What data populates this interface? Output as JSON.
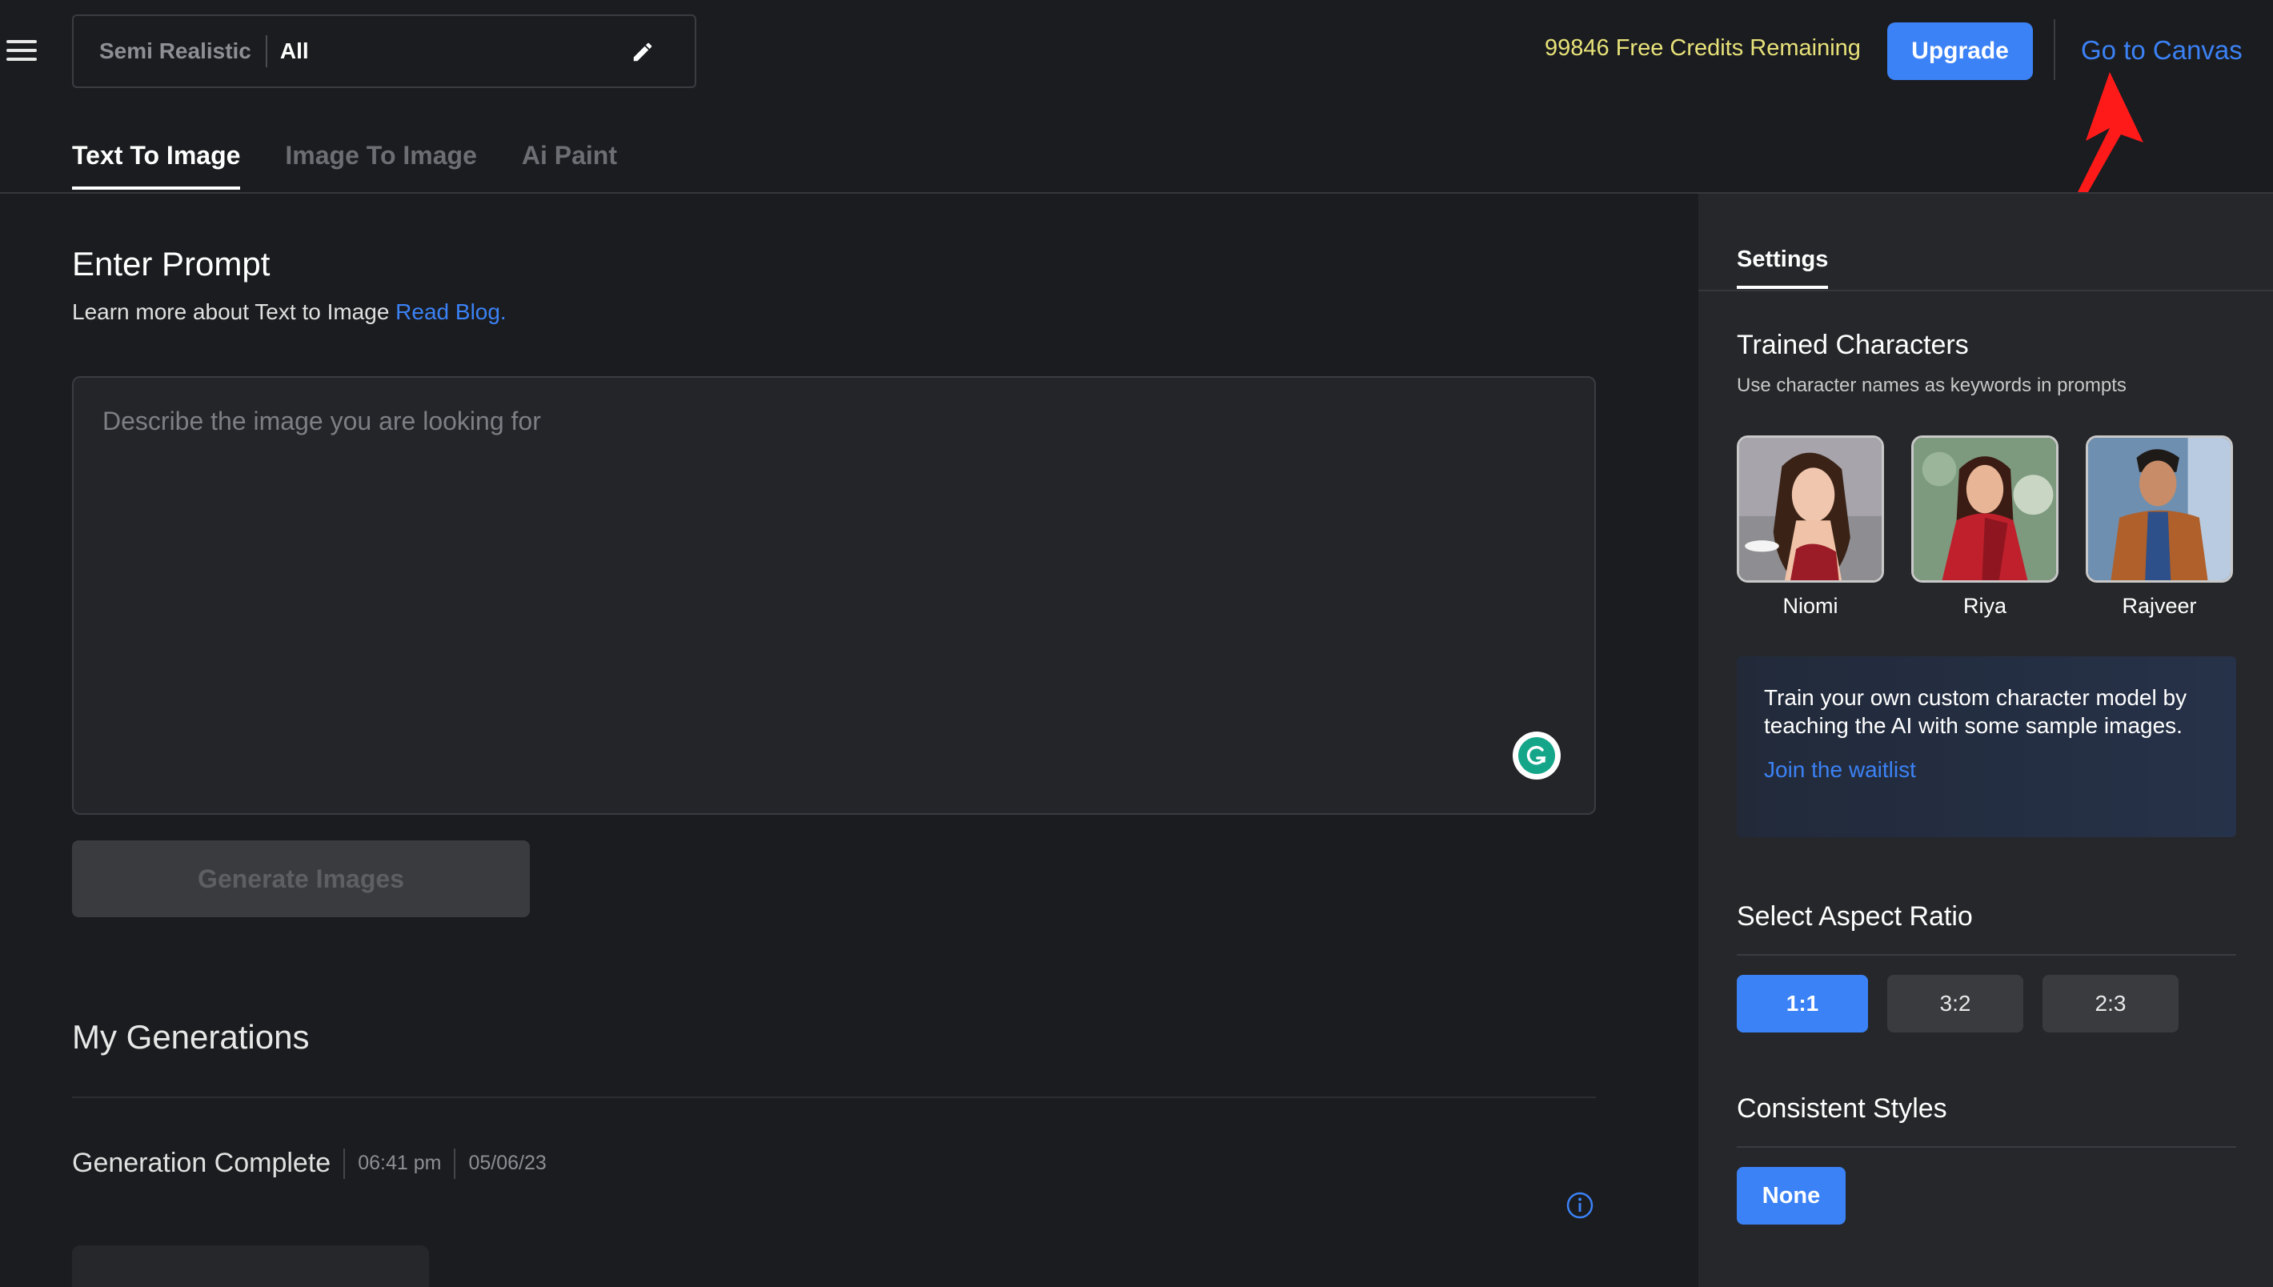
{
  "header": {
    "model_style": "Semi Realistic",
    "model_category": "All",
    "credits_text": "99846 Free Credits Remaining",
    "upgrade_label": "Upgrade",
    "canvas_label": "Go to Canvas"
  },
  "tabs": [
    {
      "label": "Text To Image",
      "active": true
    },
    {
      "label": "Image To Image",
      "active": false
    },
    {
      "label": "Ai Paint",
      "active": false
    }
  ],
  "prompt": {
    "title": "Enter Prompt",
    "learn_text": "Learn more about Text to Image",
    "learn_link": "Read Blog.",
    "placeholder": "Describe the image you are looking for",
    "value": ""
  },
  "generate_label": "Generate Images",
  "generations": {
    "title": "My Generations",
    "items": [
      {
        "status": "Generation Complete",
        "time": "06:41 pm",
        "date": "05/06/23"
      }
    ]
  },
  "settings": {
    "tab_label": "Settings",
    "trained_characters": {
      "title": "Trained Characters",
      "subtitle": "Use character names as keywords in prompts",
      "characters": [
        {
          "name": "Niomi"
        },
        {
          "name": "Riya"
        },
        {
          "name": "Rajveer"
        }
      ]
    },
    "train_box": {
      "text": "Train your own custom character model by teaching the AI with some sample images.",
      "link": "Join the waitlist"
    },
    "aspect_ratio": {
      "title": "Select Aspect Ratio",
      "options": [
        "1:1",
        "3:2",
        "2:3"
      ],
      "selected": "1:1"
    },
    "consistent_styles": {
      "title": "Consistent Styles",
      "selected": "None"
    }
  },
  "colors": {
    "accent": "#3b82f6",
    "credits": "#e8e27a",
    "background": "#1b1c1f",
    "panel": "#26272a",
    "annotation_arrow": "#ff1a1a"
  },
  "icons": [
    "hamburger-menu-icon",
    "pencil-icon",
    "grammarly-icon",
    "info-icon",
    "red-annotation-arrow"
  ]
}
